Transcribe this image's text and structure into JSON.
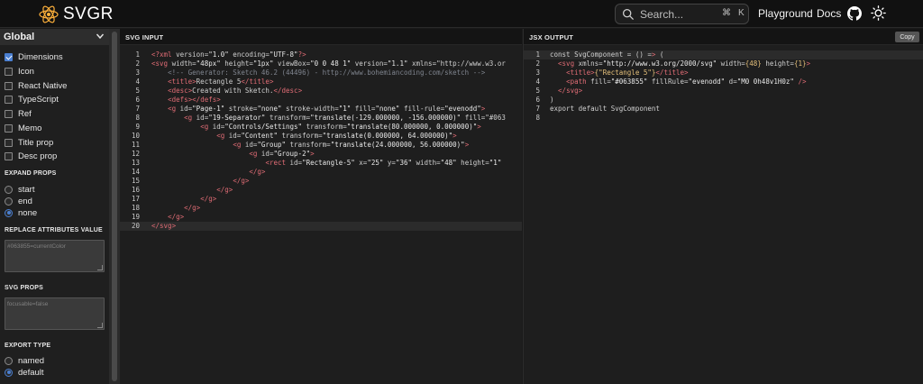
{
  "header": {
    "logo_text": "SVGR",
    "search_placeholder": "Search...",
    "kbd_cmd": "⌘",
    "kbd_k": "K",
    "nav_playground": "Playground",
    "nav_docs": "Docs"
  },
  "sidebar": {
    "preset": "Global",
    "options": [
      {
        "label": "Dimensions",
        "checked": true
      },
      {
        "label": "Icon",
        "checked": false
      },
      {
        "label": "React Native",
        "checked": false
      },
      {
        "label": "TypeScript",
        "checked": false
      },
      {
        "label": "Ref",
        "checked": false
      },
      {
        "label": "Memo",
        "checked": false
      },
      {
        "label": "Title prop",
        "checked": false
      },
      {
        "label": "Desc prop",
        "checked": false
      }
    ],
    "expand_props_title": "EXPAND PROPS",
    "expand_props": [
      {
        "label": "start",
        "selected": false
      },
      {
        "label": "end",
        "selected": false
      },
      {
        "label": "none",
        "selected": true
      }
    ],
    "replace_attr_title": "REPLACE ATTRIBUTES VALUE",
    "replace_attr_placeholder": "#063855=currentColor",
    "svg_props_title": "SVG PROPS",
    "svg_props_placeholder": "focusable=false",
    "export_type_title": "EXPORT TYPE",
    "export_type": [
      {
        "label": "named",
        "selected": false
      },
      {
        "label": "default",
        "selected": true
      }
    ]
  },
  "svg_input": {
    "title": "SVG INPUT",
    "lines": [
      {
        "n": "1",
        "text": "<?xml version=\"1.0\" encoding=\"UTF-8\"?>"
      },
      {
        "n": "2",
        "text": "<svg width=\"48px\" height=\"1px\" viewBox=\"0 0 48 1\" version=\"1.1\" xmlns=\"http://www.w3.or"
      },
      {
        "n": "3",
        "text": "    <!-- Generator: Sketch 46.2 (44496) - http://www.bohemiancoding.com/sketch -->"
      },
      {
        "n": "4",
        "text": "    <title>Rectangle 5</title>"
      },
      {
        "n": "5",
        "text": "    <desc>Created with Sketch.</desc>"
      },
      {
        "n": "6",
        "text": "    <defs></defs>"
      },
      {
        "n": "7",
        "text": "    <g id=\"Page-1\" stroke=\"none\" stroke-width=\"1\" fill=\"none\" fill-rule=\"evenodd\">"
      },
      {
        "n": "8",
        "text": "        <g id=\"19-Separator\" transform=\"translate(-129.000000, -156.000000)\" fill=\"#063"
      },
      {
        "n": "9",
        "text": "            <g id=\"Controls/Settings\" transform=\"translate(80.000000, 0.000000)\">"
      },
      {
        "n": "10",
        "text": "                <g id=\"Content\" transform=\"translate(0.000000, 64.000000)\">"
      },
      {
        "n": "11",
        "text": "                    <g id=\"Group\" transform=\"translate(24.000000, 56.000000)\">"
      },
      {
        "n": "12",
        "text": "                        <g id=\"Group-2\">"
      },
      {
        "n": "13",
        "text": "                            <rect id=\"Rectangle-5\" x=\"25\" y=\"36\" width=\"48\" height=\"1\""
      },
      {
        "n": "14",
        "text": "                        </g>"
      },
      {
        "n": "15",
        "text": "                    </g>"
      },
      {
        "n": "16",
        "text": "                </g>"
      },
      {
        "n": "17",
        "text": "            </g>"
      },
      {
        "n": "18",
        "text": "        </g>"
      },
      {
        "n": "19",
        "text": "    </g>"
      },
      {
        "n": "20",
        "text": "</svg>"
      }
    ]
  },
  "jsx_output": {
    "title": "JSX OUTPUT",
    "copy_label": "Copy",
    "lines": [
      {
        "n": "1",
        "text": "const SvgComponent = () => ("
      },
      {
        "n": "2",
        "text": "  <svg xmlns=\"http://www.w3.org/2000/svg\" width={48} height={1}>"
      },
      {
        "n": "3",
        "text": "    <title>{\"Rectangle 5\"}</title>"
      },
      {
        "n": "4",
        "text": "    <path fill=\"#063855\" fillRule=\"evenodd\" d=\"M0 0h48v1H0z\" />"
      },
      {
        "n": "5",
        "text": "  </svg>"
      },
      {
        "n": "6",
        "text": ")"
      },
      {
        "n": "7",
        "text": "export default SvgComponent"
      },
      {
        "n": "8",
        "text": ""
      }
    ]
  },
  "colors": {
    "accent": "#4a7fd1",
    "tag": "#e06c75",
    "comment": "#7f848e",
    "component_name": "#e5c07b"
  }
}
